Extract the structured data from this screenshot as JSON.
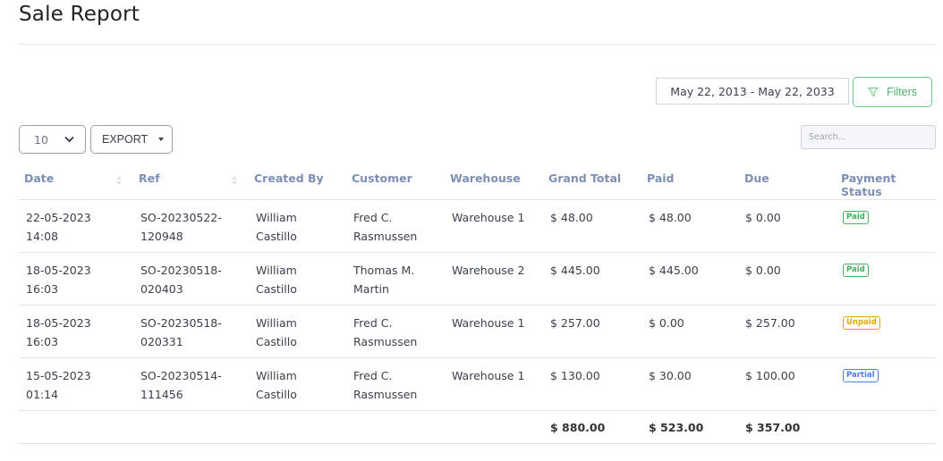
{
  "page": {
    "title": "Sale Report"
  },
  "toolbar": {
    "date_range": "May 22, 2013 - May 22, 2033",
    "filters_label": "Filters",
    "per_page": "10",
    "export_label": "EXPORT",
    "search_placeholder": "Search..."
  },
  "table": {
    "columns": [
      "Date",
      "Ref",
      "Created By",
      "Customer",
      "Warehouse",
      "Grand Total",
      "Paid",
      "Due",
      "Payment Status"
    ],
    "rows": [
      {
        "date": "22-05-2023",
        "time": "14:08",
        "ref1": "SO-20230522-",
        "ref2": "120948",
        "created1": "William",
        "created2": "Castillo",
        "cust1": "Fred C.",
        "cust2": "Rasmussen",
        "warehouse": "Warehouse 1",
        "grand_total": "$ 48.00",
        "paid": "$ 48.00",
        "due": "$ 0.00",
        "status": "Paid",
        "status_kind": "paid"
      },
      {
        "date": "18-05-2023",
        "time": "16:03",
        "ref1": "SO-20230518-",
        "ref2": "020403",
        "created1": "William",
        "created2": "Castillo",
        "cust1": "Thomas M.",
        "cust2": "Martin",
        "warehouse": "Warehouse 2",
        "grand_total": "$ 445.00",
        "paid": "$ 445.00",
        "due": "$ 0.00",
        "status": "Paid",
        "status_kind": "paid"
      },
      {
        "date": "18-05-2023",
        "time": "16:03",
        "ref1": "SO-20230518-",
        "ref2": "020331",
        "created1": "William",
        "created2": "Castillo",
        "cust1": "Fred C.",
        "cust2": "Rasmussen",
        "warehouse": "Warehouse 1",
        "grand_total": "$ 257.00",
        "paid": "$ 0.00",
        "due": "$ 257.00",
        "status": "Unpaid",
        "status_kind": "unpaid"
      },
      {
        "date": "15-05-2023",
        "time": "01:14",
        "ref1": "SO-20230514-",
        "ref2": "111456",
        "created1": "William",
        "created2": "Castillo",
        "cust1": "Fred C.",
        "cust2": "Rasmussen",
        "warehouse": "Warehouse 1",
        "grand_total": "$ 130.00",
        "paid": "$ 30.00",
        "due": "$ 100.00",
        "status": "Partial",
        "status_kind": "partial"
      }
    ],
    "totals": {
      "grand_total": "$ 880.00",
      "paid": "$ 523.00",
      "due": "$ 357.00"
    }
  },
  "colors": {
    "paid": "#3fb35e",
    "unpaid": "#e5a410",
    "partial": "#4a82d9",
    "header_text": "#7d8fb5",
    "filters_accent": "#4caf6b"
  },
  "icons": {
    "filter": "filter-icon",
    "chevron": "chevron-down-icon",
    "sort": "sort-icon",
    "caret": "caret-down-icon"
  }
}
